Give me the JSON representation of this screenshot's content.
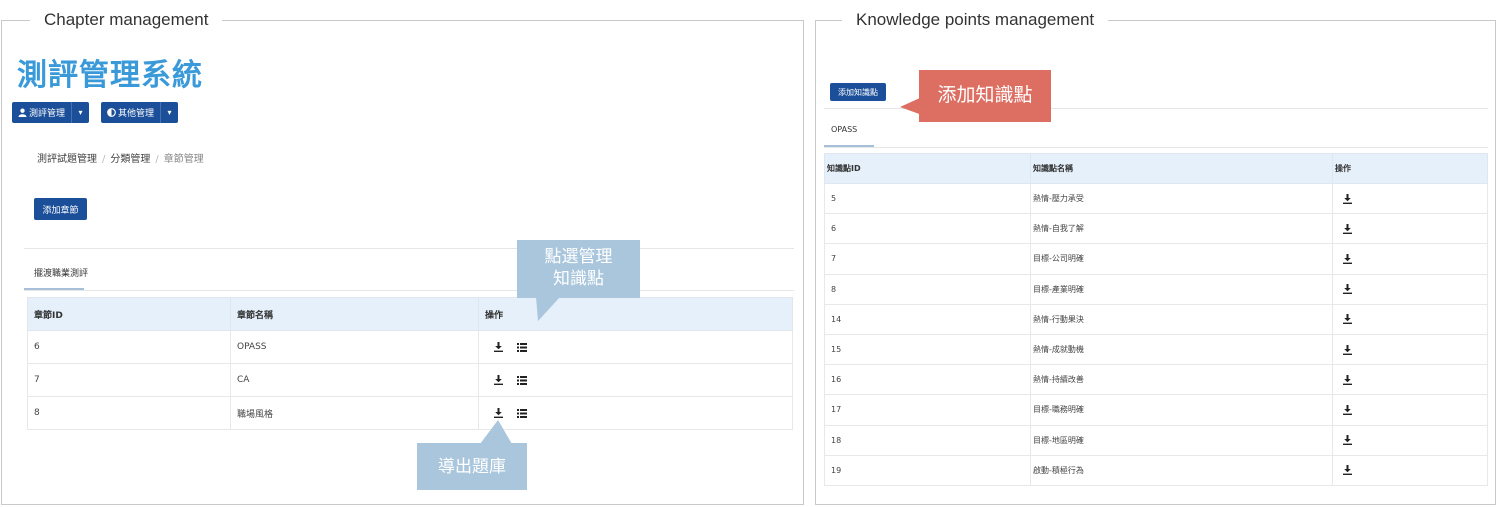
{
  "chapter": {
    "panel_title": "Chapter management",
    "app_title": "測評管理系統",
    "menus": [
      {
        "label": "測評管理",
        "icon": "user-icon"
      },
      {
        "label": "其他管理",
        "icon": "half-circle-icon"
      }
    ],
    "breadcrumb": [
      "測評試題管理",
      "分類管理",
      "章節管理"
    ],
    "add_button": "添加章節",
    "tab": "擺渡職業測評",
    "table": {
      "headers": [
        "章節ID",
        "章節名稱",
        "操作"
      ],
      "rows": [
        {
          "id": "6",
          "name": "OPASS"
        },
        {
          "id": "7",
          "name": "CA"
        },
        {
          "id": "8",
          "name": "職場風格"
        }
      ]
    },
    "callout_manage_line1": "點選管理",
    "callout_manage_line2": "知識點",
    "callout_export": "導出題庫",
    "colors": {
      "primary": "#1b4f9a",
      "title": "#3a9ad9",
      "callout_blue": "#a9c6dc"
    }
  },
  "knowledge": {
    "panel_title": "Knowledge points management",
    "add_button": "添加知識點",
    "callout_add": "添加知識點",
    "tab": "OPASS",
    "table": {
      "headers": [
        "知識點ID",
        "知識點名稱",
        "操作"
      ],
      "rows": [
        {
          "id": "5",
          "name": "熱情-壓力承受"
        },
        {
          "id": "6",
          "name": "熱情-自我了解"
        },
        {
          "id": "7",
          "name": "目標-公司明確"
        },
        {
          "id": "8",
          "name": "目標-產業明確"
        },
        {
          "id": "14",
          "name": "熱情-行動果決"
        },
        {
          "id": "15",
          "name": "熱情-成就動機"
        },
        {
          "id": "16",
          "name": "熱情-持續改善"
        },
        {
          "id": "17",
          "name": "目標-職務明確"
        },
        {
          "id": "18",
          "name": "目標-地區明確"
        },
        {
          "id": "19",
          "name": "啟動-積極行為"
        }
      ]
    },
    "colors": {
      "callout_red": "#dc6e62"
    }
  }
}
